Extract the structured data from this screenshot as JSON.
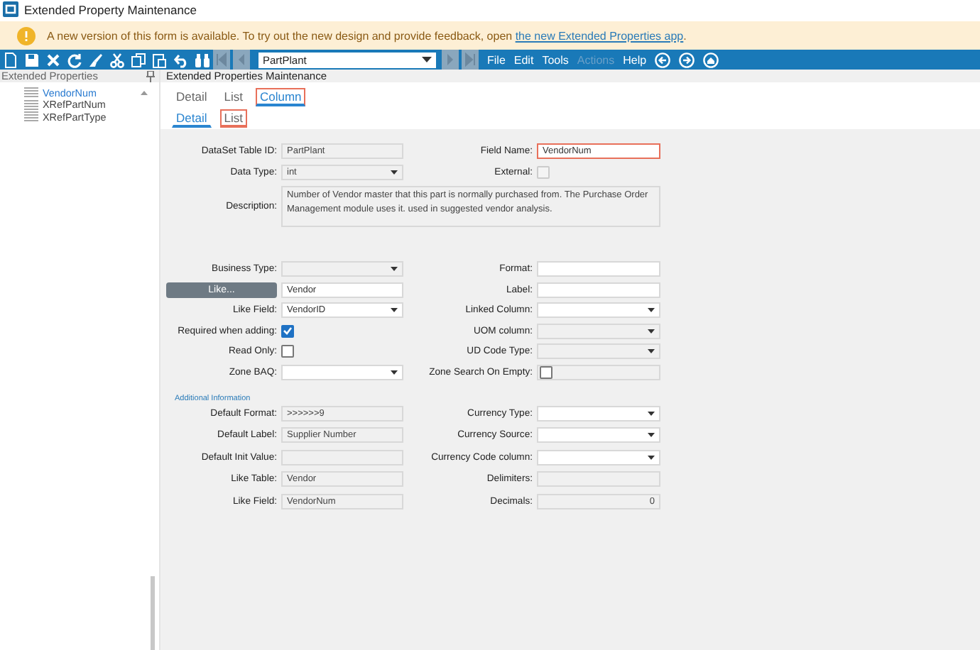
{
  "window": {
    "title": "Extended Property Maintenance"
  },
  "banner": {
    "text": "A new version of this form is available. To try out the new design and provide feedback, open ",
    "link": "the new Extended Properties app",
    "trailing": "."
  },
  "toolbar": {
    "record": "PartPlant",
    "menus": [
      {
        "label": "File",
        "disabled": false
      },
      {
        "label": "Edit",
        "disabled": false
      },
      {
        "label": "Tools",
        "disabled": false
      },
      {
        "label": "Actions",
        "disabled": true
      },
      {
        "label": "Help",
        "disabled": false
      }
    ]
  },
  "sidebar": {
    "title": "Extended Properties",
    "items": [
      {
        "label": "VendorNum",
        "selected": true
      },
      {
        "label": "XRefPartNum",
        "selected": false
      },
      {
        "label": "XRefPartType",
        "selected": false
      }
    ]
  },
  "main": {
    "title": "Extended Properties Maintenance",
    "tabs": [
      {
        "label": "Detail",
        "selected": false,
        "highlighted": false
      },
      {
        "label": "List",
        "selected": false,
        "highlighted": false
      },
      {
        "label": "Column",
        "selected": true,
        "highlighted": true
      }
    ],
    "subtabs": [
      {
        "label": "Detail",
        "selected": true,
        "highlighted": false
      },
      {
        "label": "List",
        "selected": false,
        "highlighted": true
      }
    ],
    "top_rows": [
      [
        {
          "label": "DataSet Table ID:",
          "kind": "text",
          "value": "PartPlant",
          "disabled": true,
          "highlighted": false
        },
        {
          "label": "Field Name:",
          "kind": "text",
          "value": "VendorNum",
          "disabled": false,
          "highlighted": true
        }
      ],
      [
        {
          "label": "Data Type:",
          "kind": "combo",
          "value": "int",
          "disabled": true
        },
        {
          "label": "External:",
          "kind": "check",
          "checked": false,
          "disabled": true
        }
      ]
    ],
    "description": {
      "label": "Description:",
      "value": "Number of Vendor master that this part is normally purchased from. The Purchase Order Management module uses it.  used in suggested vendor analysis."
    },
    "mid_rows": [
      [
        {
          "label": "Business Type:",
          "kind": "combo",
          "disabled": true
        },
        {
          "label": "Format:",
          "kind": "text",
          "disabled": false
        }
      ],
      [
        {
          "button": "Like...",
          "kind": "text",
          "value": "Vendor",
          "disabled": false
        },
        {
          "label": "Label:",
          "kind": "text",
          "disabled": false
        }
      ],
      [
        {
          "label": "Like Field:",
          "kind": "combo",
          "value": "VendorID",
          "disabled": false
        },
        {
          "label": "Linked Column:",
          "kind": "combo",
          "disabled": false
        }
      ],
      [
        {
          "label": "Required when adding:",
          "kind": "check",
          "checked": true,
          "disabled": false
        },
        {
          "label": "UOM column:",
          "kind": "combo",
          "disabled": true
        }
      ],
      [
        {
          "label": "Read Only:",
          "kind": "check",
          "checked": false,
          "disabled": false
        },
        {
          "label": "UD Code Type:",
          "kind": "combo",
          "disabled": true
        }
      ],
      [
        {
          "label": "Zone BAQ:",
          "kind": "combo",
          "disabled": false
        },
        {
          "label": "Zone Search On Empty:",
          "kind": "checkfield",
          "checked": false,
          "disabled": true
        }
      ]
    ],
    "section_title": "Additional Information",
    "bottom_rows": [
      [
        {
          "label": "Default Format:",
          "kind": "text",
          "value": ">>>>>>9",
          "disabled": true
        },
        {
          "label": "Currency Type:",
          "kind": "combo",
          "disabled": false
        }
      ],
      [
        {
          "label": "Default Label:",
          "kind": "text",
          "value": "Supplier Number",
          "disabled": true
        },
        {
          "label": "Currency Source:",
          "kind": "combo",
          "disabled": false
        }
      ],
      [
        {
          "label": "Default Init Value:",
          "kind": "text",
          "disabled": true
        },
        {
          "label": "Currency Code column:",
          "kind": "combo",
          "disabled": false
        }
      ],
      [
        {
          "label": "Like Table:",
          "kind": "text",
          "value": "Vendor",
          "disabled": true
        },
        {
          "label": "Delimiters:",
          "kind": "text",
          "disabled": true
        }
      ],
      [
        {
          "label": "Like Field:",
          "kind": "text",
          "value": "VendorNum",
          "disabled": true
        },
        {
          "label": "Decimals:",
          "kind": "number",
          "value": "0",
          "disabled": true
        }
      ]
    ]
  }
}
